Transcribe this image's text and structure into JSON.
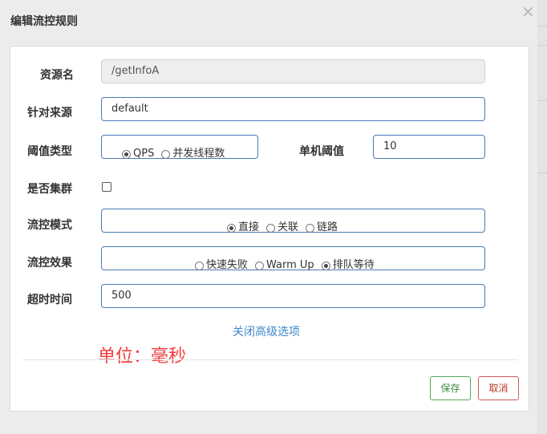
{
  "dialog": {
    "title": "编辑流控规则",
    "close_symbol": "×"
  },
  "form": {
    "resource": {
      "label": "资源名",
      "value": "/getInfoA"
    },
    "source": {
      "label": "针对来源",
      "value": "default"
    },
    "threshold_type": {
      "label": "阈值类型",
      "options": [
        "QPS",
        "并发线程数"
      ],
      "selected": "QPS"
    },
    "single_threshold": {
      "label": "单机阈值",
      "value": "10"
    },
    "cluster": {
      "label": "是否集群",
      "checked": false
    },
    "flow_mode": {
      "label": "流控模式",
      "options": [
        "直接",
        "关联",
        "链路"
      ],
      "selected": "直接"
    },
    "flow_effect": {
      "label": "流控效果",
      "options": [
        "快速失败",
        "Warm Up",
        "排队等待"
      ],
      "selected": "排队等待"
    },
    "timeout": {
      "label": "超时时间",
      "value": "500"
    }
  },
  "advanced_link": "关闭高级选项",
  "annotation": "单位：毫秒",
  "footer": {
    "save_label": "保存",
    "cancel_label": "取消"
  }
}
